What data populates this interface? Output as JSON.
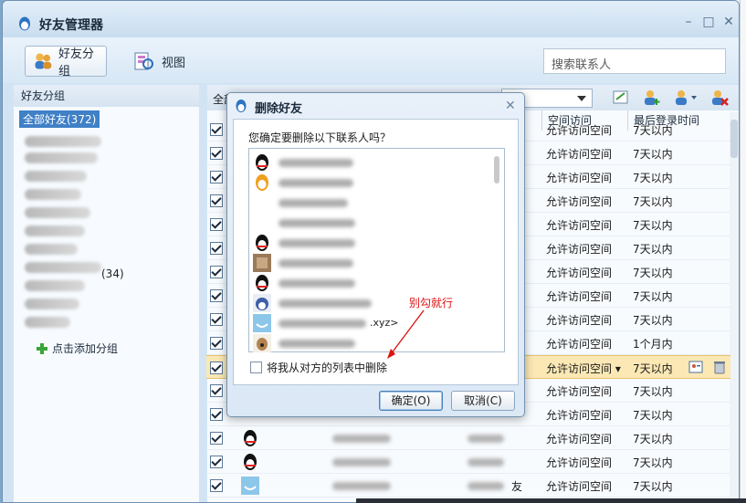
{
  "window": {
    "title": "好友管理器",
    "controls": [
      "–",
      "□",
      "✕"
    ]
  },
  "toolbar": {
    "group_label": "好友分组",
    "view_label": "视图",
    "search_placeholder": "搜索联系人"
  },
  "sidebar": {
    "header": "好友分组",
    "selected": "全部好友(372)",
    "group_count": "(34)",
    "add_group": "点击添加分组"
  },
  "list": {
    "all_label": "全部",
    "columns": {
      "space": "空间访问",
      "login": "最后登录时间"
    },
    "rows": [
      {
        "space": "允许访问空间",
        "login": "7天以内"
      },
      {
        "space": "允许访问空间",
        "login": "7天以内"
      },
      {
        "space": "允许访问空间",
        "login": "7天以内"
      },
      {
        "space": "允许访问空间",
        "login": "7天以内"
      },
      {
        "space": "允许访问空间",
        "login": "7天以内"
      },
      {
        "space": "允许访问空间",
        "login": "7天以内"
      },
      {
        "space": "允许访问空间",
        "login": "7天以内"
      },
      {
        "space": "允许访问空间",
        "login": "7天以内"
      },
      {
        "space": "允许访问空间",
        "login": "7天以内"
      },
      {
        "space": "允许访问空间",
        "login": "1个月内"
      },
      {
        "space": "允许访问空间",
        "login": "7天以内"
      },
      {
        "space": "允许访问空间",
        "login": "7天以内"
      },
      {
        "space": "允许访问空间",
        "login": "7天以内"
      },
      {
        "space": "允许访问空间",
        "login": "7天以内"
      },
      {
        "space": "允许访问空间",
        "login": "7天以内"
      },
      {
        "space": "允许访问空间",
        "login": "7天以内"
      }
    ],
    "extra_text": "友"
  },
  "dialog": {
    "title": "删除好友",
    "question": "您确定要删除以下联系人吗？",
    "list_suffix": ".xyz>",
    "checkbox_label": "将我从对方的列表中删除",
    "ok_label": "确定(O)",
    "cancel_label": "取消(C)"
  },
  "annotation": "别勾就行",
  "colors": {
    "selected_bg": "#3f80c6",
    "highlight_row": "#fbe8b4",
    "annotation": "#dd1111"
  }
}
